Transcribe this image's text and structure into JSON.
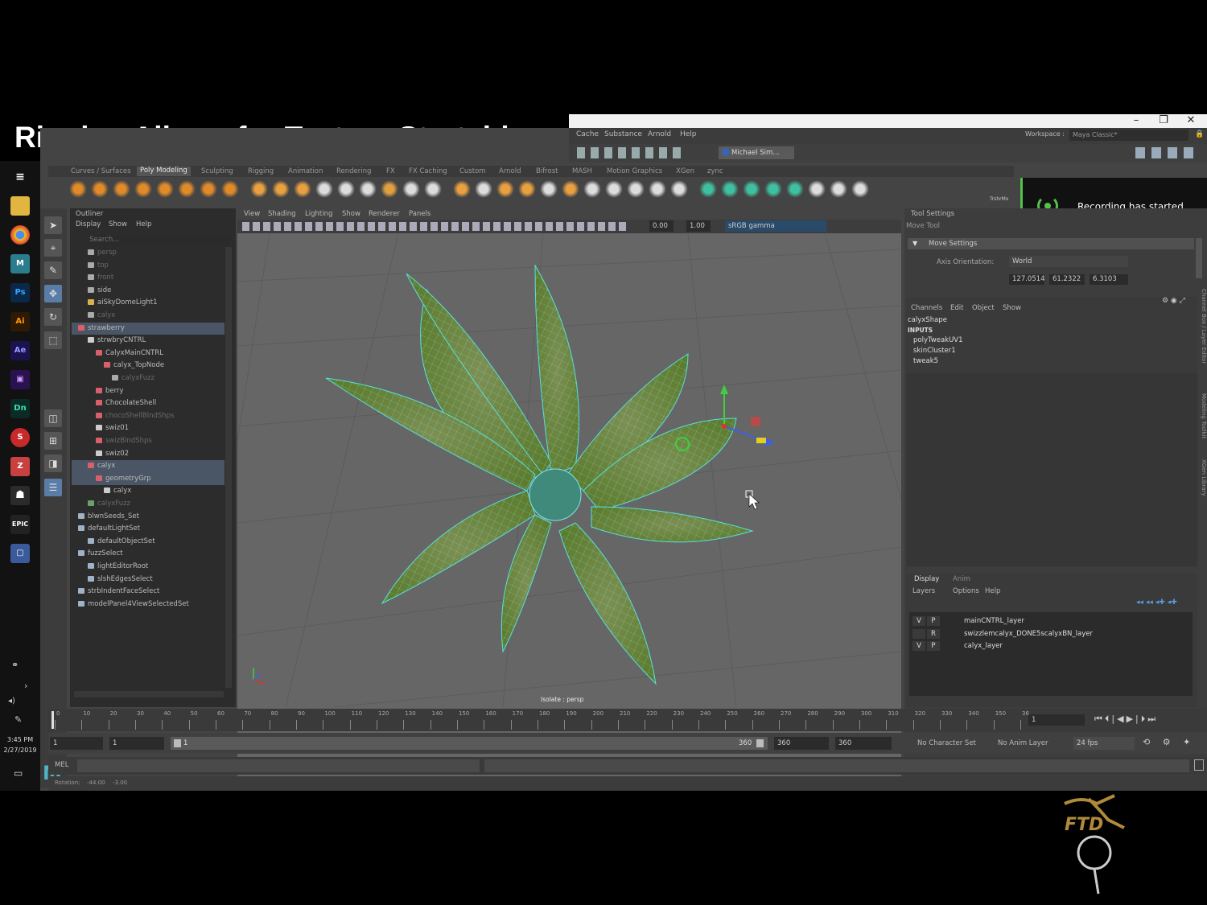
{
  "slide": {
    "title": "Rigging Allows for Texture Stretching"
  },
  "window": {
    "controls": [
      "–",
      "❐",
      "✕"
    ]
  },
  "menubar": {
    "items": [
      "Cache",
      "Substance",
      "Arnold",
      "Help"
    ],
    "workspace_label": "Workspace :",
    "workspace_value": "Maya Classic*"
  },
  "statusline": {
    "user": "Michael Sim..."
  },
  "shelf": {
    "tabs": [
      "Curves / Surfaces",
      "Poly Modeling",
      "Sculpting",
      "Rigging",
      "Animation",
      "Rendering",
      "FX",
      "FX Caching",
      "Custom",
      "Arnold",
      "Bifrost",
      "MASH",
      "Motion Graphics",
      "XGen",
      "zync"
    ],
    "active_tab": "Poly Modeling",
    "last_icon_label": "TrshrMx"
  },
  "recording": {
    "text": "Recording has started"
  },
  "outliner": {
    "title": "Outliner",
    "menus": [
      "Display",
      "Show",
      "Help"
    ],
    "search_placeholder": "Search...",
    "rows": [
      {
        "label": "persp",
        "color": "#aaaaaa",
        "dim": true,
        "selected": false
      },
      {
        "label": "top",
        "color": "#aaaaaa",
        "dim": true,
        "selected": false
      },
      {
        "label": "front",
        "color": "#aaaaaa",
        "dim": true,
        "selected": false
      },
      {
        "label": "side",
        "color": "#aaaaaa",
        "dim": false,
        "selected": false
      },
      {
        "label": "aiSkyDomeLight1",
        "color": "#d9b24a",
        "dim": false,
        "selected": false
      },
      {
        "label": "calyx",
        "color": "#aaaaaa",
        "dim": true,
        "selected": false
      },
      {
        "label": "strawberry",
        "color": "#d9606a",
        "dim": false,
        "selected": true
      },
      {
        "label": "strwbryCNTRL",
        "color": "#cccccc",
        "dim": false,
        "selected": false
      },
      {
        "label": "CalyxMainCNTRL",
        "color": "#d9606a",
        "dim": false,
        "selected": false
      },
      {
        "label": "calyx_TopNode",
        "color": "#d9606a",
        "dim": false,
        "selected": false
      },
      {
        "label": "calyxFuzz",
        "color": "#aaaaaa",
        "dim": true,
        "selected": false
      },
      {
        "label": "berry",
        "color": "#d9606a",
        "dim": false,
        "selected": false
      },
      {
        "label": "ChocolateShell",
        "color": "#d9606a",
        "dim": false,
        "selected": false
      },
      {
        "label": "chocoShellBlndShps",
        "color": "#d9606a",
        "dim": true,
        "selected": false
      },
      {
        "label": "swiz01",
        "color": "#cccccc",
        "dim": false,
        "selected": false
      },
      {
        "label": "swizBlndShps",
        "color": "#d9606a",
        "dim": true,
        "selected": false
      },
      {
        "label": "swiz02",
        "color": "#cccccc",
        "dim": false,
        "selected": false
      },
      {
        "label": "calyx",
        "color": "#d9606a",
        "dim": false,
        "selected": true
      },
      {
        "label": "geometryGrp",
        "color": "#d9606a",
        "dim": false,
        "selected": true
      },
      {
        "label": "calyx",
        "color": "#cccccc",
        "dim": false,
        "selected": false
      },
      {
        "label": "calyxFuzz",
        "color": "#6aa06a",
        "dim": true,
        "selected": false
      },
      {
        "label": "blwnSeeds_Set",
        "color": "#9fb3c8",
        "dim": false,
        "selected": false
      },
      {
        "label": "defaultLightSet",
        "color": "#9fb3c8",
        "dim": false,
        "selected": false
      },
      {
        "label": "defaultObjectSet",
        "color": "#9fb3c8",
        "dim": false,
        "selected": false
      },
      {
        "label": "fuzzSelect",
        "color": "#9fb3c8",
        "dim": false,
        "selected": false
      },
      {
        "label": "lightEditorRoot",
        "color": "#9fb3c8",
        "dim": false,
        "selected": false
      },
      {
        "label": "slshEdgesSelect",
        "color": "#9fb3c8",
        "dim": false,
        "selected": false
      },
      {
        "label": "strbIndentFaceSelect",
        "color": "#9fb3c8",
        "dim": false,
        "selected": false
      },
      {
        "label": "modelPanel4ViewSelectedSet",
        "color": "#9fb3c8",
        "dim": false,
        "selected": false
      }
    ]
  },
  "viewport": {
    "menus": [
      "View",
      "Shading",
      "Lighting",
      "Show",
      "Renderer",
      "Panels"
    ],
    "field_a": "0.00",
    "field_b": "1.00",
    "color_space": "sRGB gamma",
    "camera_label": "Isolate : persp"
  },
  "toolsettings": {
    "title": "Tool Settings",
    "tool": "Move Tool",
    "section": "Move Settings",
    "axis_label": "Axis Orientation:",
    "axis_value": "World",
    "coords": [
      "127.0514",
      "61.2322",
      "6.3103"
    ]
  },
  "channelbox": {
    "menus": [
      "Channels",
      "Edit",
      "Object",
      "Show"
    ],
    "shape": "calyxShape",
    "inputs_label": "INPUTS",
    "inputs": [
      "polyTweakUV1",
      "skinCluster1",
      "tweak5"
    ]
  },
  "side_tabs": [
    "Channel Box / Layer Editor",
    "Modeling Toolkit",
    "XGen Library"
  ],
  "layers": {
    "tabs": [
      "Display",
      "Anim"
    ],
    "menus": [
      "Layers",
      "Options",
      "Help"
    ],
    "rows": [
      {
        "v": "V",
        "p": "P",
        "name": "mainCNTRL_layer"
      },
      {
        "v": "",
        "p": "R",
        "name": "swizzlemcalyx_DONE5scalyxBN_layer"
      },
      {
        "v": "V",
        "p": "P",
        "name": "calyx_layer"
      }
    ]
  },
  "timeline": {
    "ticks": [
      "0",
      "10",
      "20",
      "30",
      "40",
      "50",
      "60",
      "70",
      "80",
      "90",
      "100",
      "110",
      "120",
      "130",
      "140",
      "150",
      "160",
      "170",
      "180",
      "190",
      "200",
      "210",
      "220",
      "230",
      "240",
      "250",
      "260",
      "270",
      "280",
      "290",
      "300",
      "310",
      "320",
      "330",
      "340",
      "350",
      "36"
    ],
    "current_frame": "1"
  },
  "range": {
    "start": "1",
    "playback_start": "1",
    "slider_start": "1",
    "slider_end": "360",
    "playback_end": "360",
    "end": "360",
    "character_set": "No Character Set",
    "anim_layer": "No Anim Layer",
    "fps": "24 fps"
  },
  "mel": {
    "label": "MEL"
  },
  "helpline": {
    "label": "Rotation:",
    "v1": "-44.00",
    "v2": "-3.00"
  },
  "clock": {
    "time": "3:45 PM",
    "date": "2/27/2019"
  },
  "watermark": {
    "text": "FTD"
  },
  "icons": {
    "taskbar": [
      "menu-icon",
      "folder-icon",
      "chrome-icon",
      "maya-icon",
      "photoshop-icon",
      "illustrator-icon",
      "after-effects-icon",
      "premiere-icon",
      "dimension-icon",
      "substance-icon",
      "zbrush-icon",
      "character-icon",
      "epic-icon",
      "monitor-icon"
    ]
  }
}
